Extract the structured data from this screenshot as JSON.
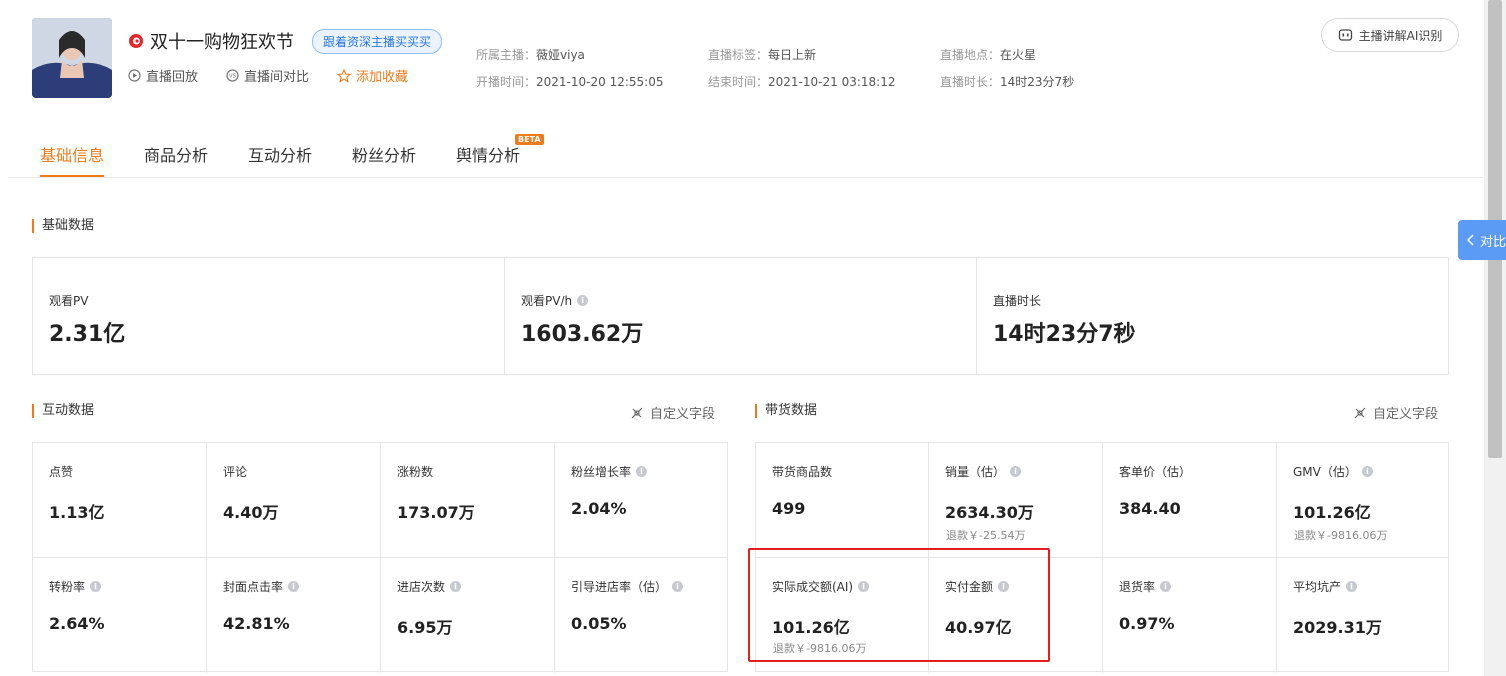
{
  "header": {
    "live_title": "双十一购物狂欢节",
    "follow_tag": "跟着资深主播买买买",
    "actions": {
      "replay": "直播回放",
      "compare": "直播间对比",
      "favorite": "添加收藏"
    },
    "meta": {
      "anchor_label": "所属主播：",
      "anchor_value": "薇娅viya",
      "tag_label": "直播标签：",
      "tag_value": "每日上新",
      "location_label": "直播地点：",
      "location_value": "在火星",
      "start_label": "开播时间：",
      "start_value": "2021-10-20 12:55:05",
      "end_label": "结束时间：",
      "end_value": "2021-10-21 03:18:12",
      "duration_label": "直播时长：",
      "duration_value": "14时23分7秒"
    },
    "ai_button": "主播讲解AI识别"
  },
  "tabs": [
    {
      "label": "基础信息"
    },
    {
      "label": "商品分析"
    },
    {
      "label": "互动分析"
    },
    {
      "label": "粉丝分析"
    },
    {
      "label": "舆情分析"
    }
  ],
  "beta_badge": "BETA",
  "basic": {
    "title": "基础数据",
    "cells": [
      {
        "label": "观看PV",
        "value": "2.31亿"
      },
      {
        "label": "观看PV/h",
        "value": "1603.62万"
      },
      {
        "label": "直播时长",
        "value": "14时23分7秒"
      }
    ]
  },
  "interaction": {
    "title": "互动数据",
    "custom": "自定义字段",
    "cells": [
      {
        "label": "点赞",
        "value": "1.13亿"
      },
      {
        "label": "评论",
        "value": "4.40万"
      },
      {
        "label": "涨粉数",
        "value": "173.07万"
      },
      {
        "label": "粉丝增长率",
        "value": "2.04%"
      },
      {
        "label": "转粉率",
        "value": "2.64%"
      },
      {
        "label": "封面点击率",
        "value": "42.81%"
      },
      {
        "label": "进店次数",
        "value": "6.95万"
      },
      {
        "label": "引导进店率（估）",
        "value": "0.05%"
      }
    ]
  },
  "sales": {
    "title": "带货数据",
    "custom": "自定义字段",
    "cells": [
      {
        "label": "带货商品数",
        "value": "499",
        "sub": ""
      },
      {
        "label": "销量（估）",
        "value": "2634.30万",
        "sub": "退款￥-25.54万"
      },
      {
        "label": "客单价（估）",
        "value": "384.40",
        "sub": ""
      },
      {
        "label": "GMV（估）",
        "value": "101.26亿",
        "sub": "退款￥-9816.06万"
      },
      {
        "label": "实际成交额(AI)",
        "value": "101.26亿",
        "sub": "退款￥-9816.06万"
      },
      {
        "label": "实付金额",
        "value": "40.97亿",
        "sub": ""
      },
      {
        "label": "退货率",
        "value": "0.97%",
        "sub": ""
      },
      {
        "label": "平均坑产",
        "value": "2029.31万",
        "sub": ""
      }
    ]
  },
  "compare_tab": "对比",
  "colors": {
    "accent": "#f07a1a",
    "link_blue": "#2a78e4",
    "highlight_red": "#e02020"
  }
}
